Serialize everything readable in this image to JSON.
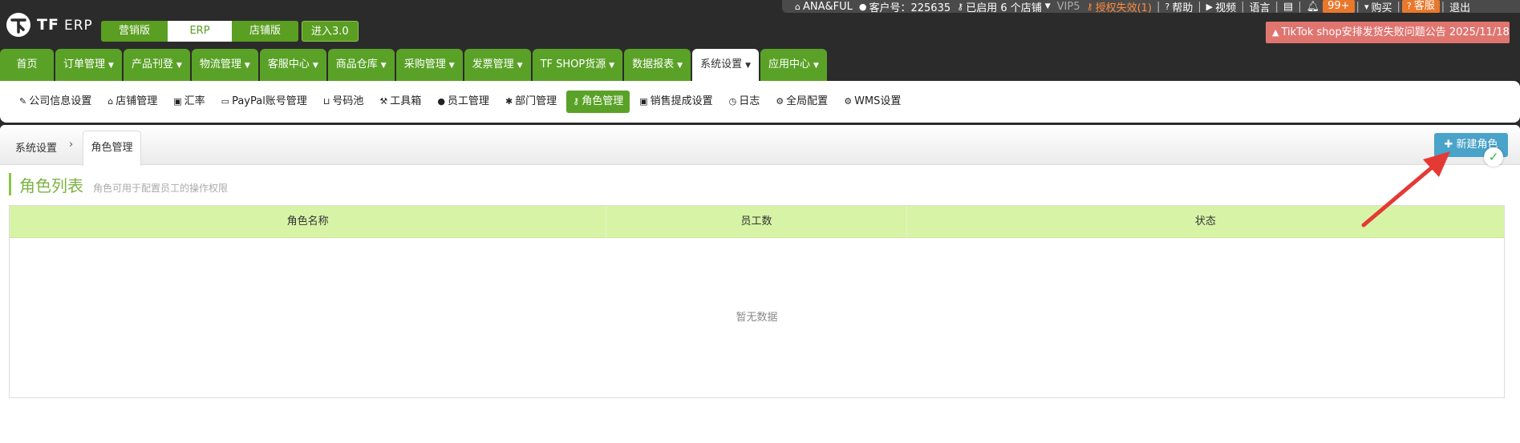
{
  "topbar": {
    "logo_brand": "TF",
    "logo_product": "ERP",
    "editions": [
      {
        "label": "营销版",
        "active": false
      },
      {
        "label": "ERP",
        "active": true
      },
      {
        "label": "店铺版",
        "active": false
      }
    ],
    "enter_label": "进入3.0"
  },
  "userbar": {
    "store_name": "ANA&FUL",
    "customer_label": "客户号：225635",
    "stores_enabled": "已启用 6 个店铺",
    "vip": "VIP5",
    "auth_status": "授权失效(1)",
    "help": "帮助",
    "video": "视频",
    "language": "语言",
    "notify_count": "99+",
    "buy": "购买",
    "service": "客服",
    "logout": "退出"
  },
  "notice": "TikTok shop安排发货失败问题公告 2025/11/18",
  "mainnav": [
    {
      "label": "首页",
      "dropdown": false,
      "active": false
    },
    {
      "label": "订单管理",
      "dropdown": true,
      "active": false
    },
    {
      "label": "产品刊登",
      "dropdown": true,
      "active": false
    },
    {
      "label": "物流管理",
      "dropdown": true,
      "active": false
    },
    {
      "label": "客服中心",
      "dropdown": true,
      "active": false
    },
    {
      "label": "商品仓库",
      "dropdown": true,
      "active": false
    },
    {
      "label": "采购管理",
      "dropdown": true,
      "active": false
    },
    {
      "label": "发票管理",
      "dropdown": true,
      "active": false
    },
    {
      "label": "TF SHOP货源",
      "dropdown": true,
      "active": false
    },
    {
      "label": "数据报表",
      "dropdown": true,
      "active": false
    },
    {
      "label": "系统设置",
      "dropdown": true,
      "active": true
    },
    {
      "label": "应用中心",
      "dropdown": true,
      "active": false
    }
  ],
  "subnav": [
    {
      "label": "公司信息设置",
      "icon": "edit-icon",
      "glyph": "✎",
      "active": false
    },
    {
      "label": "店铺管理",
      "icon": "home-icon",
      "glyph": "⌂",
      "active": false
    },
    {
      "label": "汇率",
      "icon": "money-icon",
      "glyph": "▣",
      "active": false
    },
    {
      "label": "PayPal账号管理",
      "icon": "card-icon",
      "glyph": "▭",
      "active": false
    },
    {
      "label": "号码池",
      "icon": "inbox-icon",
      "glyph": "⊔",
      "active": false
    },
    {
      "label": "工具箱",
      "icon": "gavel-icon",
      "glyph": "⚒",
      "active": false
    },
    {
      "label": "员工管理",
      "icon": "user-icon",
      "glyph": "●",
      "active": false
    },
    {
      "label": "部门管理",
      "icon": "asterisk-icon",
      "glyph": "✱",
      "active": false
    },
    {
      "label": "角色管理",
      "icon": "key-icon",
      "glyph": "⚷",
      "active": true
    },
    {
      "label": "销售提成设置",
      "icon": "money-icon",
      "glyph": "▣",
      "active": false
    },
    {
      "label": "日志",
      "icon": "clock-icon",
      "glyph": "◷",
      "active": false
    },
    {
      "label": "全局配置",
      "icon": "cog-icon",
      "glyph": "⚙",
      "active": false
    },
    {
      "label": "WMS设置",
      "icon": "cog-icon",
      "glyph": "⚙",
      "active": false
    }
  ],
  "breadcrumb": {
    "root": "系统设置",
    "current": "角色管理"
  },
  "new_role_label": "新建角色",
  "section": {
    "title": "角色列表",
    "subtitle": "角色可用于配置员工的操作权限"
  },
  "table": {
    "columns": [
      "角色名称",
      "员工数",
      "状态"
    ],
    "empty_text": "暂无数据"
  },
  "colors": {
    "brand_green": "#5aa227",
    "header_green": "#d7f4a6",
    "notice_red": "#e07570",
    "button_blue": "#4aa3c9",
    "arrow_red": "#e53935"
  }
}
